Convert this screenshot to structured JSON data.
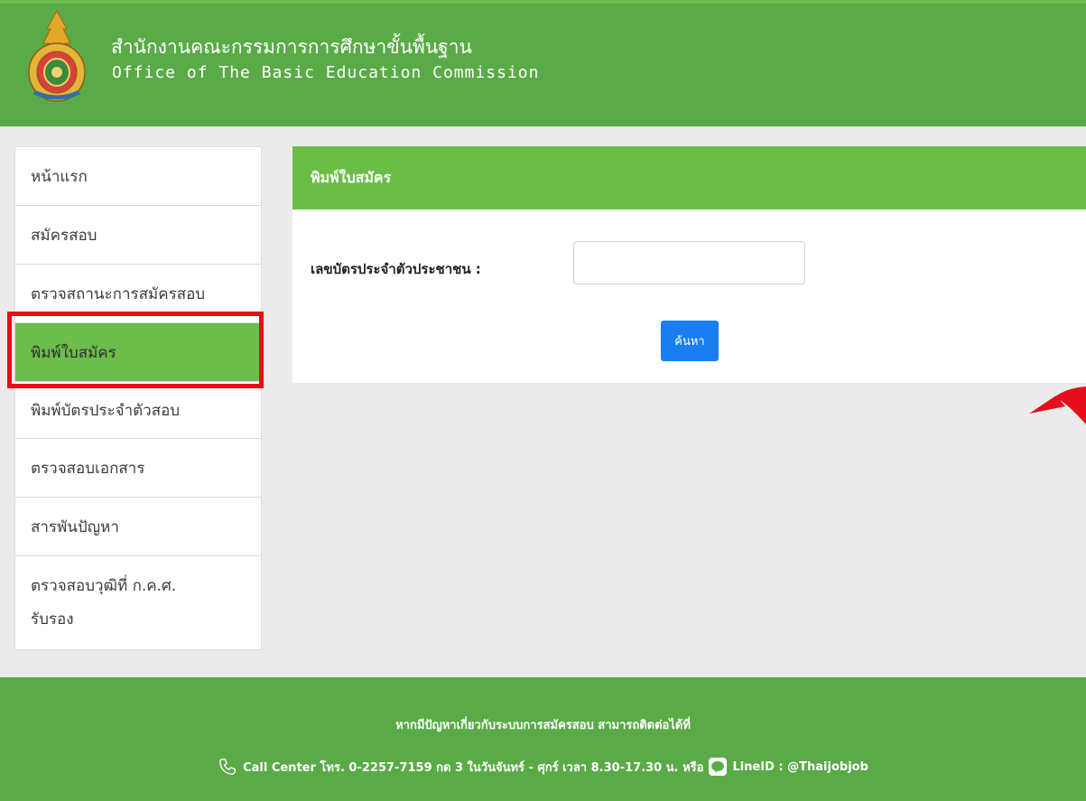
{
  "header": {
    "title_th": "สำนักงานคณะกรรมการการศึกษาขั้นพื้นฐาน",
    "title_en": "Office of The Basic Education Commission",
    "logo_icon": "obec-emblem-logo"
  },
  "sidebar": {
    "items": [
      {
        "label": "หน้าแรก"
      },
      {
        "label": "สมัครสอบ"
      },
      {
        "label": "ตรวจสถานะการสมัครสอบ"
      },
      {
        "label": "พิมพ์ใบสมัคร",
        "active": true
      },
      {
        "label": "พิมพ์บัตรประจำตัวสอบ"
      },
      {
        "label": "ตรวจสอบเอกสาร"
      },
      {
        "label": "สารพันปัญหา"
      },
      {
        "label_line1": "ตรวจสอบวุฒิที่ ก.ค.ศ.",
        "label_line2": "รับรอง"
      }
    ]
  },
  "panel": {
    "title": "พิมพ์ใบสมัคร",
    "id_label": "เลขบัตรประจำตัวประชาชน :",
    "id_value": "",
    "search_label": "ค้นหา"
  },
  "footer": {
    "line1": "หากมีปัญหาเกี่ยวกับระบบการสมัครสอบ สามารถติดต่อได้ที่",
    "call_center": "Call Center โทร. 0-2257-7159 กด 3 ในวันจันทร์ - ศุกร์ เวลา 8.30-17.30 น. หรือ",
    "line_id": "LineID : @Thaijobjob"
  },
  "colors": {
    "header_green": "#5aab47",
    "active_green": "#6cbd4b",
    "button_blue": "#1a7ef2",
    "highlight_red": "#e80e15"
  }
}
